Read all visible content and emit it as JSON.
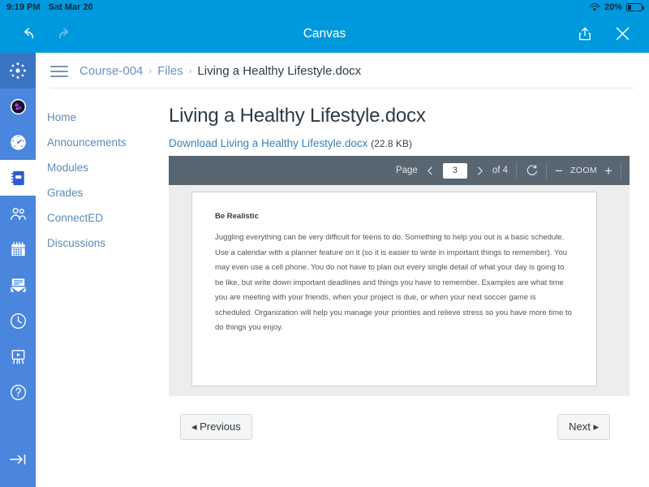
{
  "status_bar": {
    "time": "9:19 PM",
    "date": "Sat Mar 20",
    "battery_percent": "20%",
    "wifi_icon": "wifi-icon",
    "battery_icon": "battery-icon"
  },
  "app_bar": {
    "title": "Canvas",
    "back_icon": "back-arrow-icon",
    "forward_icon": "forward-arrow-icon",
    "share_icon": "share-icon",
    "close_icon": "close-icon"
  },
  "global_nav": {
    "items": [
      {
        "name": "canvas-logo",
        "icon": "canvas-logo-icon",
        "active": false
      },
      {
        "name": "account",
        "icon": "avatar-icon",
        "active": false
      },
      {
        "name": "dashboard",
        "icon": "dashboard-speedometer-icon",
        "active": false
      },
      {
        "name": "courses",
        "icon": "courses-notebook-icon",
        "active": true
      },
      {
        "name": "groups",
        "icon": "groups-people-icon",
        "active": false
      },
      {
        "name": "calendar",
        "icon": "calendar-icon",
        "active": false
      },
      {
        "name": "inbox",
        "icon": "inbox-envelope-icon",
        "active": false
      },
      {
        "name": "history",
        "icon": "history-clock-icon",
        "active": false
      },
      {
        "name": "studio",
        "icon": "studio-screen-icon",
        "active": false
      },
      {
        "name": "help",
        "icon": "help-question-icon",
        "active": false
      }
    ],
    "bottom_item": {
      "name": "collapse-nav",
      "icon": "arrow-to-right-icon"
    }
  },
  "breadcrumb": {
    "menu_icon": "hamburger-menu-icon",
    "separator": "›",
    "items": [
      {
        "label": "Course-004",
        "current": false
      },
      {
        "label": "Files",
        "current": false
      },
      {
        "label": "Living a Healthy Lifestyle.docx",
        "current": true
      }
    ]
  },
  "course_nav": {
    "items": [
      {
        "label": "Home"
      },
      {
        "label": "Announcements"
      },
      {
        "label": "Modules"
      },
      {
        "label": "Grades"
      },
      {
        "label": "ConnectED"
      },
      {
        "label": "Discussions"
      }
    ]
  },
  "document": {
    "title": "Living a Healthy Lifestyle.docx",
    "download_label": "Download Living a Healthy Lifestyle.docx",
    "file_size": "(22.8 KB)"
  },
  "viewer_toolbar": {
    "page_label": "Page",
    "prev_page_icon": "chevron-left-icon",
    "next_page_icon": "chevron-right-icon",
    "page_value": "3",
    "page_total": "of 4",
    "rotate_icon": "rotate-icon",
    "zoom_out_label": "−",
    "zoom_label": "ZOOM",
    "zoom_in_label": "+"
  },
  "pdf_page": {
    "heading": "Be Realistic",
    "body": "Juggling everything can be very difficult for teens to do. Something to help you out is a basic schedule. Use a calendar with a planner feature on it (so it is easier to write in important things to remember). You may even use a cell phone. You do not have to plan out every single detail of what your day is going to be like, but write down important deadlines and things you have to remember. Examples are what time you are meeting with your friends, when your project is due, or when your next soccer game is scheduled. Organization will help you manage your priorities and relieve stress so you have more time to do things you enjoy."
  },
  "footer_nav": {
    "previous_label": "◂ Previous",
    "next_label": "Next ▸"
  },
  "colors": {
    "app_bar_blue": "#0099DD",
    "global_nav_blue": "#4A86DE",
    "global_nav_active_bg": "#FFFFFF",
    "toolbar_slate": "#586672",
    "link_blue": "#5C8AB8",
    "viewer_bg": "#EDEDED"
  }
}
